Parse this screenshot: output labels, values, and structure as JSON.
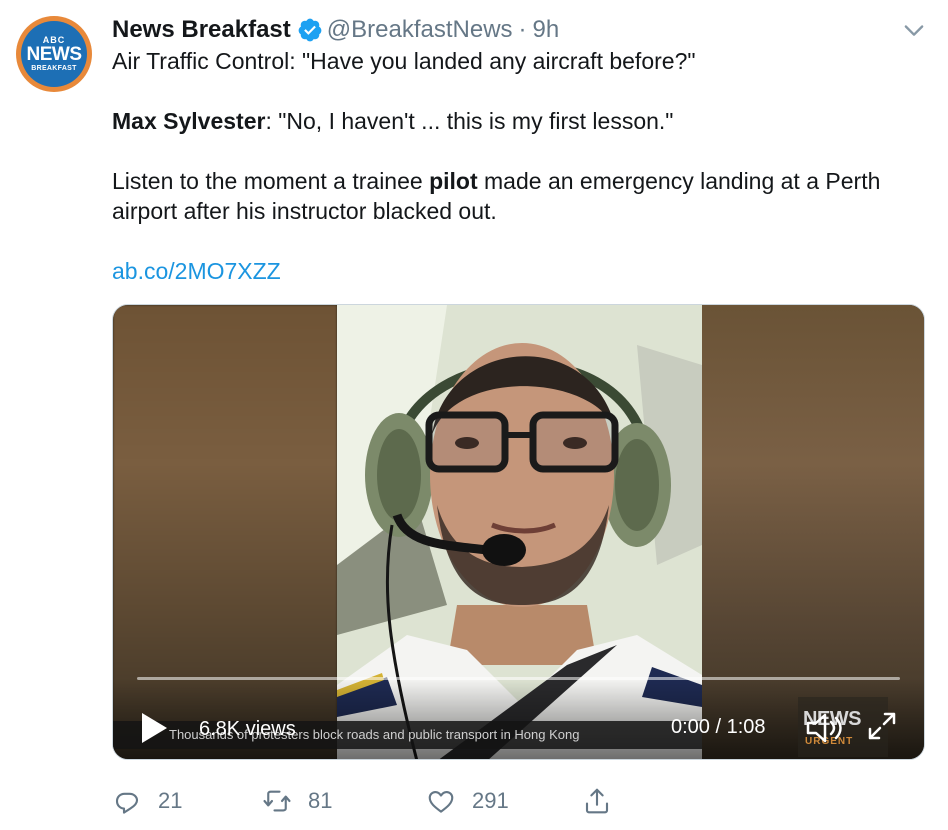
{
  "account": {
    "avatar_abc": "ABC",
    "avatar_news": "NEWS",
    "avatar_sub": "BREAKFAST",
    "name": "News Breakfast",
    "handle": "@BreakfastNews",
    "separator": "·",
    "time": "9h"
  },
  "tweet": {
    "line1": "Air Traffic Control: \"Have you landed any aircraft before?\"",
    "line2_bold": "Max Sylvester",
    "line2_rest": ": \"No, I haven't ... this is my first lesson.\"",
    "line3_pre": "Listen to the moment a trainee ",
    "line3_bold": "pilot",
    "line3_post": " made an emergency landing at a Perth airport after his instructor blacked out.",
    "link": "ab.co/2MO7XZZ"
  },
  "video": {
    "views": "6.8K views",
    "time": "0:00 / 1:08",
    "ticker": "Thousands of protesters block roads and public transport in Hong Kong",
    "logo_news": "NEWS",
    "logo_sub": "URGENT",
    "progress": 0.0
  },
  "actions": {
    "replies": "21",
    "retweets": "81",
    "likes": "291"
  },
  "colors": {
    "link": "#1b95e0",
    "verified": "#1da1f2",
    "muted": "#657786",
    "brand_orange": "#e8893a",
    "brand_blue": "#1d6fb5"
  },
  "icons": [
    "verified-badge-icon",
    "chevron-down-icon",
    "play-icon",
    "volume-icon",
    "fullscreen-icon",
    "reply-icon",
    "retweet-icon",
    "like-icon",
    "share-icon"
  ]
}
